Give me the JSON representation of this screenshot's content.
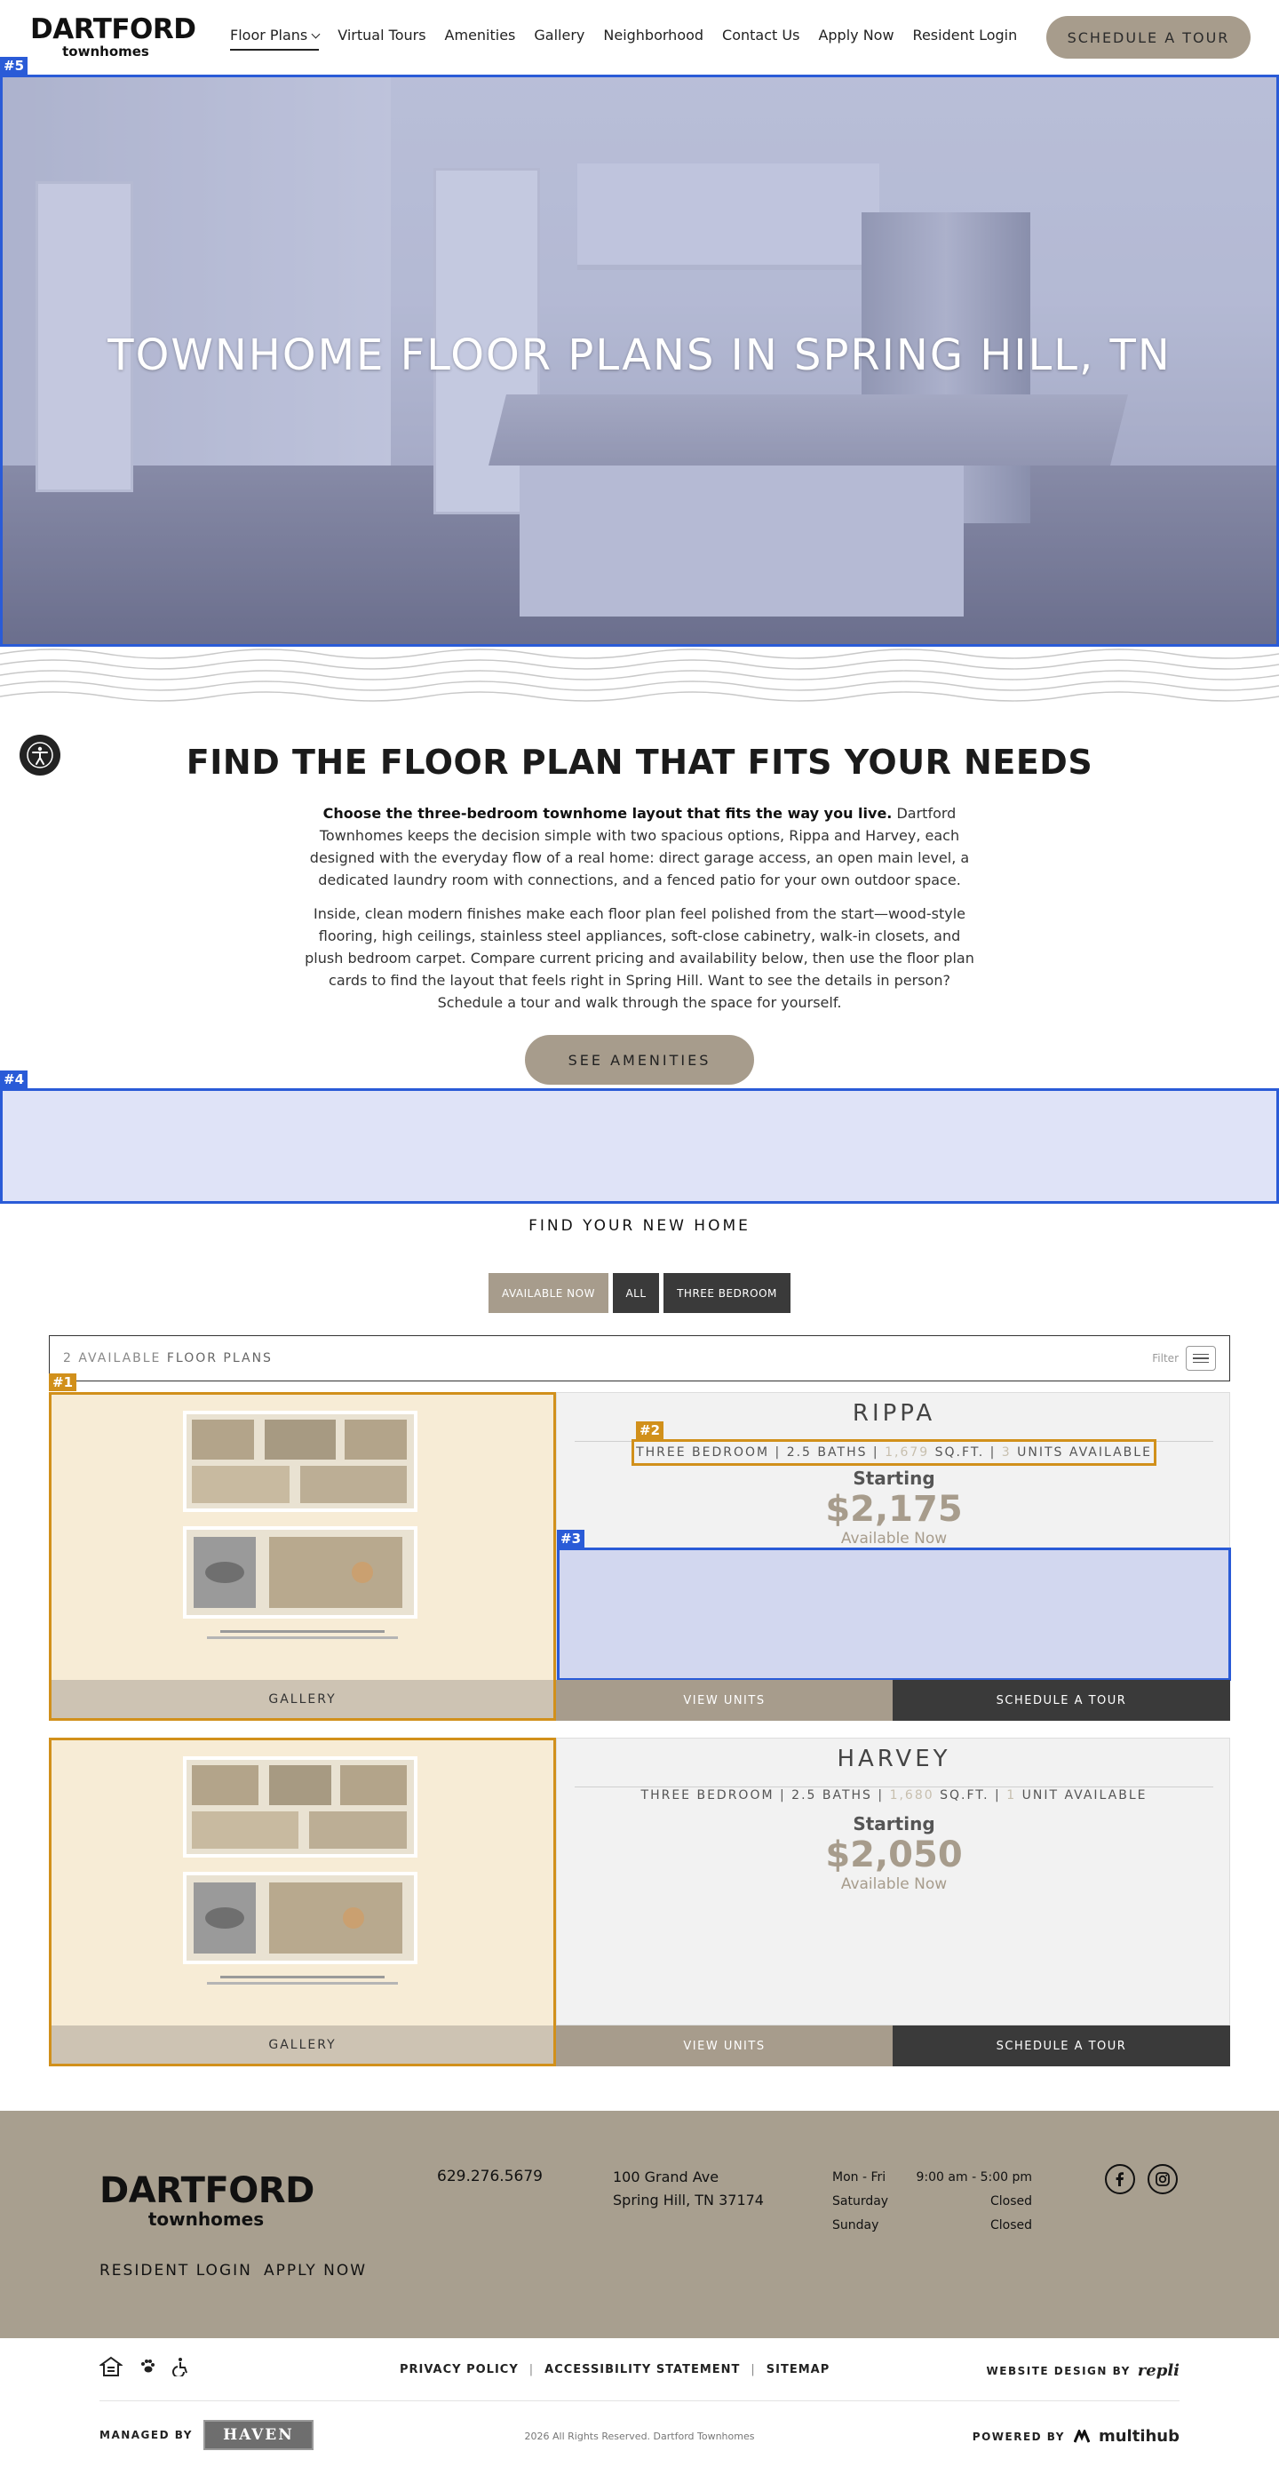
{
  "header": {
    "logo_main": "DARTFORD",
    "logo_sub": "townhomes",
    "nav": [
      "Floor Plans",
      "Virtual Tours",
      "Amenities",
      "Gallery",
      "Neighborhood",
      "Contact Us",
      "Apply Now",
      "Resident Login"
    ],
    "cta": "SCHEDULE A TOUR"
  },
  "hero": {
    "title": "TOWNHOME FLOOR PLANS IN SPRING HILL, TN",
    "tag": "#5"
  },
  "intro": {
    "title": "FIND THE FLOOR PLAN THAT FITS YOUR NEEDS",
    "p1_bold": "Choose the three-bedroom townhome layout that fits the way you live.",
    "p1_rest": " Dartford Townhomes keeps the decision simple with two spacious options, Rippa and Harvey, each designed with the everyday flow of a real home: direct garage access, an open main level, a dedicated laundry room with connections, and a fenced patio for your own outdoor space.",
    "p2": "Inside, clean modern finishes make each floor plan feel polished from the start—wood-style flooring, high ceilings, stainless steel appliances, soft-close cabinetry, walk-in closets, and plush bedroom carpet. Compare current pricing and availability below, then use the floor plan cards to find the layout that feels right in Spring Hill. Want to see the details in person? Schedule a tour and walk through the space for yourself.",
    "button": "SEE AMENITIES"
  },
  "tags": {
    "t4": "#4",
    "t1": "#1",
    "t2": "#2",
    "t3": "#3"
  },
  "listing": {
    "heading": "FIND YOUR NEW HOME",
    "filters": [
      "AVAILABLE NOW",
      "ALL",
      "THREE BEDROOM"
    ],
    "count_number": "2",
    "count_available": "AVAILABLE",
    "count_label": "FLOOR PLANS",
    "filter_label": "Filter"
  },
  "plans": [
    {
      "name": "RIPPA",
      "specs_prefix": "THREE BEDROOM | 2.5 BATHS | ",
      "sqft": "1,679",
      "specs_mid": " SQ.FT. | ",
      "units": "3",
      "units_label": " UNITS AVAILABLE",
      "starting": "Starting",
      "price": "$2,175",
      "availability": "Available Now",
      "gallery": "GALLERY",
      "view_units": "VIEW UNITS",
      "schedule": "SCHEDULE A TOUR"
    },
    {
      "name": "HARVEY",
      "specs_prefix": "THREE BEDROOM | 2.5 BATHS | ",
      "sqft": "1,680",
      "specs_mid": " SQ.FT. | ",
      "units": "1",
      "units_label": " UNIT AVAILABLE",
      "starting": "Starting",
      "price": "$2,050",
      "availability": "Available Now",
      "gallery": "GALLERY",
      "view_units": "VIEW UNITS",
      "schedule": "SCHEDULE A TOUR"
    }
  ],
  "footer": {
    "logo_main": "DARTFORD",
    "logo_sub": "townhomes",
    "resident_login": "RESIDENT LOGIN",
    "apply_now": "APPLY NOW",
    "phone": "629.276.5679",
    "address_line1": "100 Grand Ave",
    "address_line2": "Spring Hill, TN 37174",
    "hours": [
      {
        "day": "Mon - Fri",
        "time": "9:00 am - 5:00 pm"
      },
      {
        "day": "Saturday",
        "time": "Closed"
      },
      {
        "day": "Sunday",
        "time": "Closed"
      }
    ]
  },
  "bottom": {
    "links": [
      "PRIVACY POLICY",
      "ACCESSIBILITY STATEMENT",
      "SITEMAP"
    ],
    "website_design": "WEBSITE DESIGN BY",
    "repli": "repli",
    "managed_by": "MANAGED BY",
    "haven": "HAVEN",
    "copyright": "2026 All Rights Reserved. Dartford Townhomes",
    "powered_by": "POWERED BY",
    "multihub": "multihub"
  },
  "colors": {
    "accent": "#a79c8c",
    "dark": "#3a3a3a",
    "highlight_blue": "#2a5bd7",
    "highlight_orange": "#d1901b"
  }
}
